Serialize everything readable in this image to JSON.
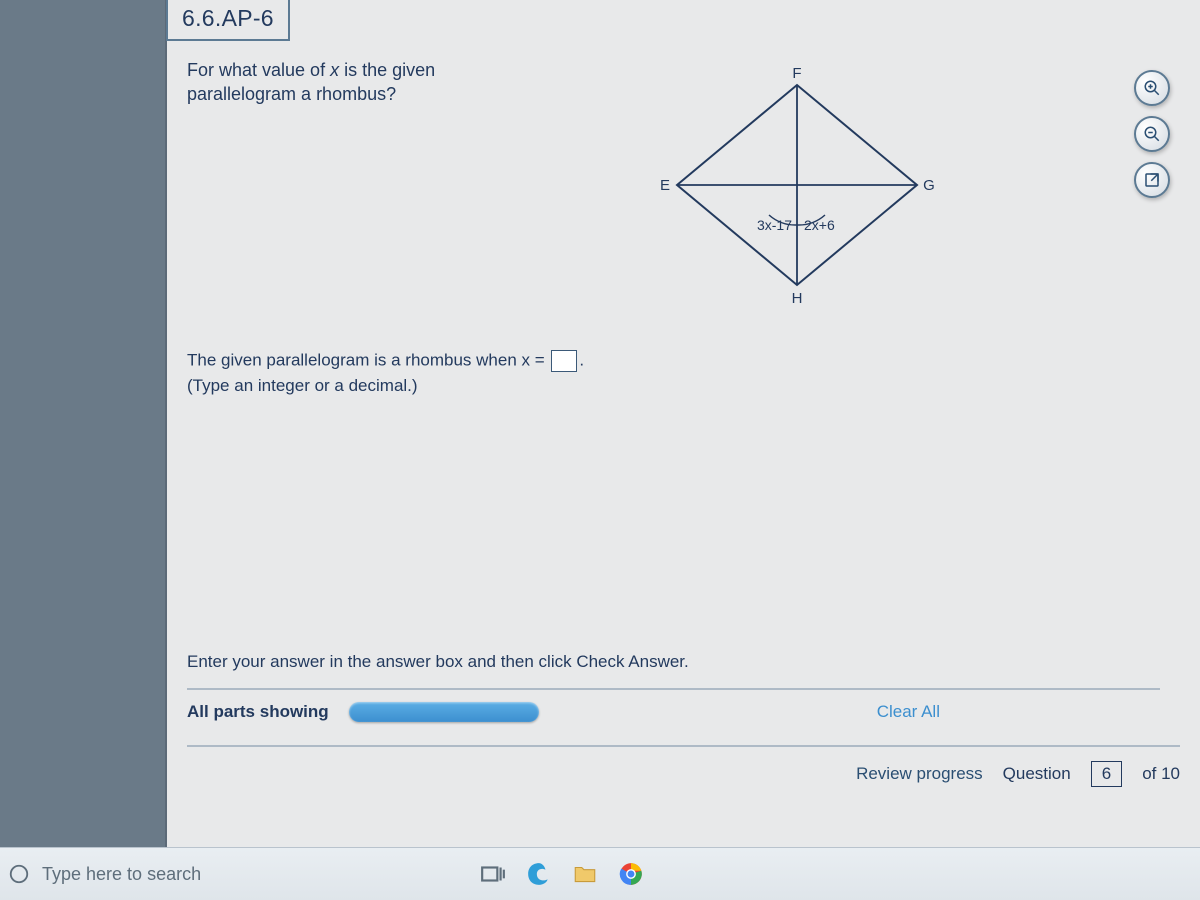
{
  "problem_id": "6.6.AP-6",
  "question_prefix": "For what value of ",
  "question_var": "x",
  "question_suffix": " is the given parallelogram a rhombus?",
  "diagram": {
    "E": "E",
    "F": "F",
    "G": "G",
    "H": "H",
    "left_expr": "3x-17",
    "right_expr": "2x+6"
  },
  "answer_prefix": "The given parallelogram is a rhombus when x =",
  "answer_period": ".",
  "answer_hint": "(Type an integer or a decimal.)",
  "footer_instruction": "Enter your answer in the answer box and then click Check Answer.",
  "parts_label": "All parts showing",
  "clear_all": "Clear All",
  "review_label": "Review progress",
  "question_word": "Question",
  "question_num": "6",
  "question_of": "of 10",
  "taskbar": {
    "search_placeholder": "Type here to search"
  }
}
